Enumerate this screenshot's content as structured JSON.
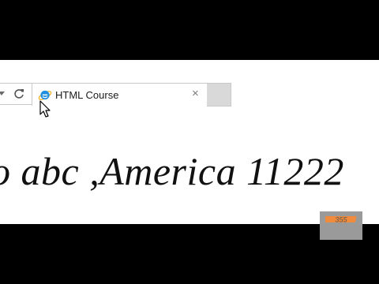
{
  "browser": {
    "tab": {
      "title": "HTML Course",
      "close_glyph": "×",
      "favicon": "ie-logo-icon"
    },
    "toolbar": {
      "dropdown_icon": "chevron-down-icon",
      "refresh_icon": "refresh-icon"
    }
  },
  "page": {
    "headline": "o abc ,America 11222"
  },
  "overlay": {
    "cursor": "mouse-cursor-icon",
    "watermark": "watermark-logo",
    "watermark_text": "355"
  },
  "colors": {
    "page_background": "#ffffff",
    "letterbox": "#000000",
    "tab_border": "#c9c9c9",
    "ie_blue": "#1e8fe0",
    "ie_gold": "#f2b632",
    "watermark_orange": "#f08a3c"
  }
}
